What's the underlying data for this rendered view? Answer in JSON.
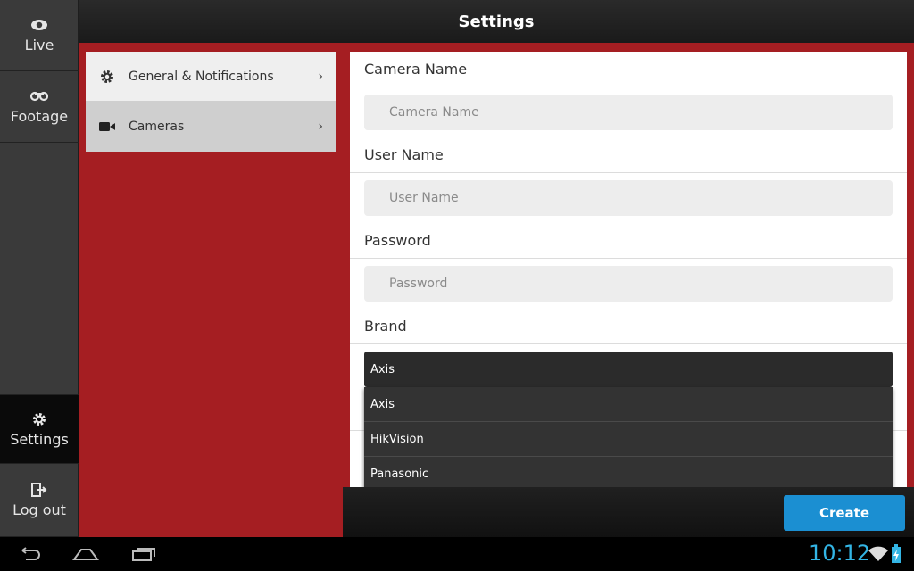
{
  "header": {
    "title": "Settings"
  },
  "rail": {
    "live": {
      "label": "Live",
      "icon": "eye-icon"
    },
    "footage": {
      "label": "Footage",
      "icon": "tape-icon"
    },
    "settings": {
      "label": "Settings",
      "icon": "gear-icon"
    },
    "logout": {
      "label": "Log out",
      "icon": "logout-icon"
    }
  },
  "submenu": {
    "items": [
      {
        "label": "General & Notifications",
        "icon": "gear-icon",
        "chevron": "›"
      },
      {
        "label": "Cameras",
        "icon": "video-camera-icon",
        "chevron": "›"
      }
    ]
  },
  "form": {
    "camera_name": {
      "label": "Camera Name",
      "placeholder": "Camera Name",
      "value": ""
    },
    "user_name": {
      "label": "User Name",
      "placeholder": "User Name",
      "value": ""
    },
    "password": {
      "label": "Password",
      "placeholder": "Password",
      "value": ""
    },
    "brand": {
      "label": "Brand",
      "selected": "Axis",
      "options": [
        "Axis",
        "HikVision",
        "Panasonic"
      ]
    },
    "create_label": "Create"
  },
  "system_bar": {
    "time": "10:12"
  },
  "colors": {
    "accent_red": "#a51e22",
    "button_blue": "#1b8fd2",
    "clock_blue": "#33b5e5"
  }
}
